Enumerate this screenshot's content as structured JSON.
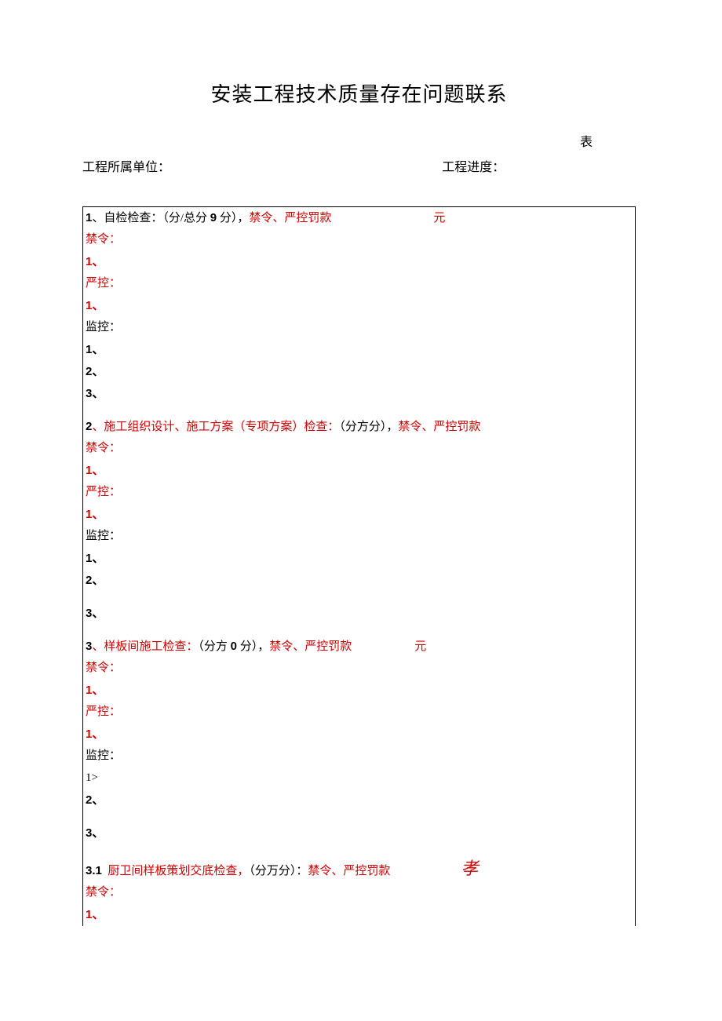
{
  "title": "安装工程技术质量存在问题联系",
  "table_marker": "表",
  "header": {
    "unit_label": "工程所属单位：",
    "progress_label": "工程进度："
  },
  "sections": [
    {
      "num": "1",
      "title_black_1": "、自检检查：（",
      "title_black_2": "分/总分 ",
      "title_bold_num": "9",
      "title_black_3": " 分），",
      "title_red": "禁令、严控罚款",
      "yuan": "元",
      "jinling_label": "禁令：",
      "jinling_items": [
        "1、"
      ],
      "yankong_label": "严控：",
      "yankong_items": [
        "1、"
      ],
      "jiankong_label": "监控：",
      "jiankong_items": [
        "1、",
        "2、",
        "3、"
      ]
    },
    {
      "num": "2",
      "title_red_1": "、施工组织设计、施工方案（专项方案）检查：",
      "title_black": "（分方分），",
      "title_red_2": "禁令、严控罚款",
      "jinling_label": "禁令：",
      "jinling_items": [
        "1、"
      ],
      "yankong_label": "严控：",
      "yankong_items": [
        "1、"
      ],
      "jiankong_label": "监控：",
      "jiankong_items": [
        "1、",
        "2、",
        "3、"
      ]
    },
    {
      "num": "3",
      "title_red_1": "、样板间施工检查：",
      "title_black_1": "（分方 ",
      "title_bold_num": "0",
      "title_black_2": " 分），",
      "title_red_2": "禁令、严控罚款",
      "yuan": "元",
      "jinling_label": "禁令：",
      "jinling_items": [
        "1、"
      ],
      "yankong_label": "严控：",
      "yankong_items": [
        "1、"
      ],
      "jiankong_label": "监控：",
      "jiankong_items": [
        "1>",
        "2、",
        "3、"
      ]
    },
    {
      "num": "3.1",
      "title_red_1": "厨卫间样板策划交底检查，",
      "title_black": "（分万分）：",
      "title_red_2": "禁令、严控罚款",
      "script": "孝",
      "jinling_label": "禁令：",
      "jinling_items": [
        "1、"
      ]
    }
  ]
}
